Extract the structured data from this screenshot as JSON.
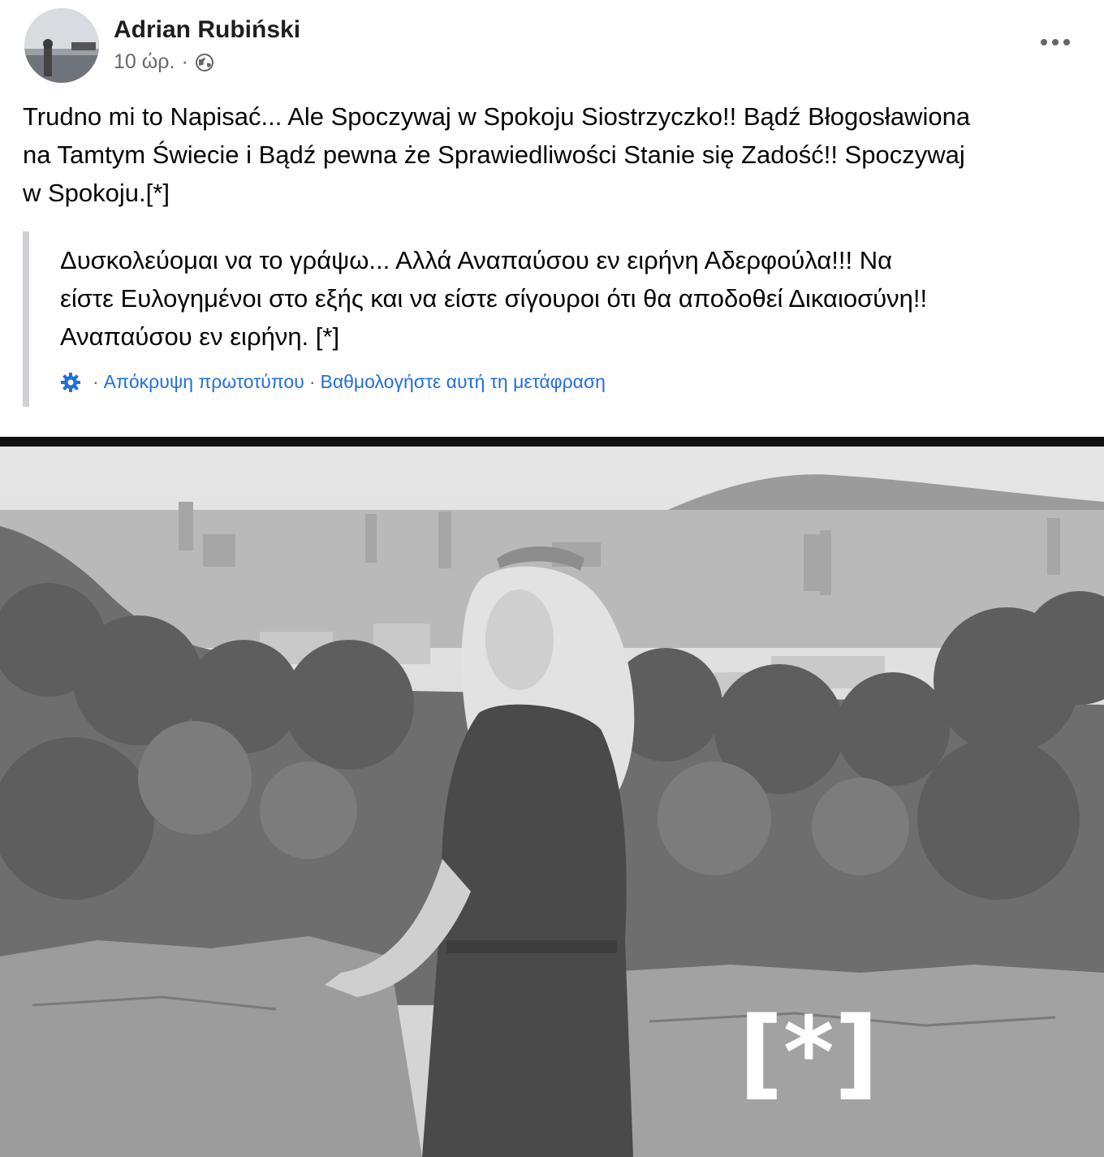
{
  "post": {
    "author": "Adrian Rubiński",
    "time": "10 ώρ.",
    "separator": "·",
    "privacy_icon": "globe-icon",
    "more_icon": "more-options-icon",
    "text_lines": [
      "Trudno mi to Napisać... Ale Spoczywaj w Spokoju Siostrzyczko!! Bądź Błogosławiona",
      "na Tamtym Świecie i Bądź pewna  że Sprawiedliwości Stanie się Zadość!! Spoczywaj",
      "w Spokoju.[*]"
    ]
  },
  "translation": {
    "text_lines": [
      "Δυσκολεύομαι να το γράψω... Αλλά Αναπαύσου εν ειρήνη Αδερφούλα!!! Να",
      "είστε Ευλογημένοι στο εξής και να είστε σίγουροι ότι θα αποδοθεί Δικαιοσύνη!!",
      "Αναπαύσου εν ειρήνη. [*]"
    ],
    "settings_icon": "gear-icon",
    "separator": "·",
    "hide_original_label": "Απόκρυψη πρωτοτύπου",
    "rate_translation_label": "Βαθμολογήστε αυτή τη μετάφραση",
    "link_color": "#216fdb"
  },
  "photo": {
    "watermark": "[*]",
    "tone": "grayscale"
  }
}
